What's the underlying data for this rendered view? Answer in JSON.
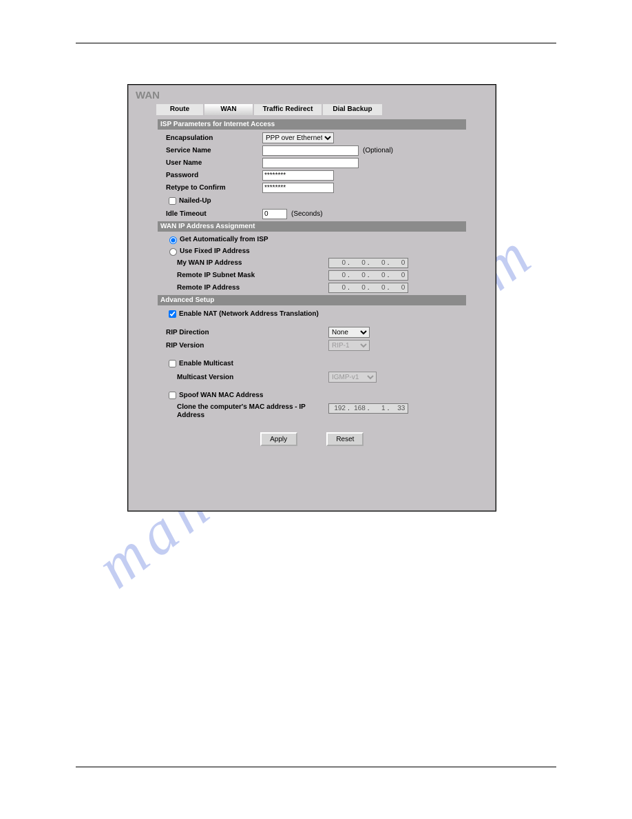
{
  "watermark": "manualshive.com",
  "title": "WAN",
  "tabs": {
    "route": "Route",
    "wan": "WAN",
    "traffic": "Traffic Redirect",
    "dial": "Dial Backup"
  },
  "sect1": {
    "head": "ISP Parameters for Internet Access",
    "encap_label": "Encapsulation",
    "encap_value": "PPP over Ethernet",
    "service_label": "Service Name",
    "service_value": "",
    "service_opt": "(Optional)",
    "user_label": "User Name",
    "user_value": "",
    "pass_label": "Password",
    "pass_value": "********",
    "retype_label": "Retype to Confirm",
    "retype_value": "********",
    "nailed_label": "Nailed-Up",
    "idle_label": "Idle Timeout",
    "idle_value": "0",
    "idle_unit": "(Seconds)"
  },
  "sect2": {
    "head": "WAN IP Address Assignment",
    "rad_auto": "Get Automatically from ISP",
    "rad_fixed": "Use Fixed IP Address",
    "wanip_label": "My WAN IP Address",
    "subnet_label": "Remote IP Subnet Mask",
    "remote_label": "Remote IP Address",
    "ip_wan": [
      "0",
      "0",
      "0",
      "0"
    ],
    "ip_sub": [
      "0",
      "0",
      "0",
      "0"
    ],
    "ip_rem": [
      "0",
      "0",
      "0",
      "0"
    ]
  },
  "sect3": {
    "head": "Advanced Setup",
    "nat_label": "Enable NAT (Network Address Translation)",
    "ripdir_label": "RIP Direction",
    "ripdir_value": "None",
    "ripver_label": "RIP Version",
    "ripver_value": "RIP-1",
    "mcast_label": "Enable Multicast",
    "mcastver_label": "Multicast Version",
    "mcastver_value": "IGMP-v1",
    "spoof_label": "Spoof WAN MAC Address",
    "clone_label": "Clone the computer's MAC address - IP Address",
    "ip_clone": [
      "192",
      "168",
      "1",
      "33"
    ]
  },
  "buttons": {
    "apply": "Apply",
    "reset": "Reset"
  }
}
